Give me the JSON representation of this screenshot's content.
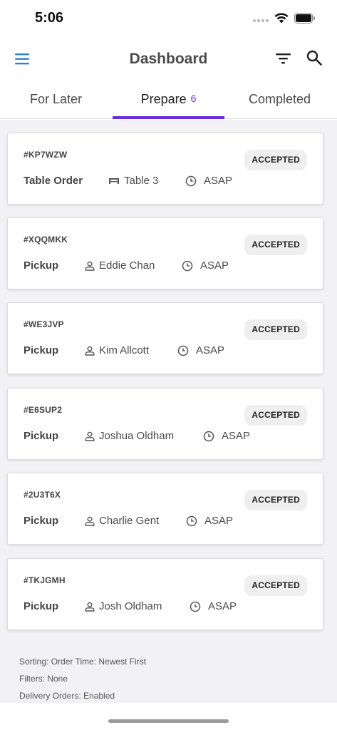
{
  "status_bar": {
    "time": "5:06"
  },
  "header": {
    "title": "Dashboard",
    "menu_icon": "hamburger-menu-icon",
    "filter_icon": "filter-icon",
    "search_icon": "search-icon",
    "accent_color": "#2f7fd6"
  },
  "tabs": [
    {
      "label": "For Later",
      "badge": ""
    },
    {
      "label": "Prepare",
      "badge": "6"
    },
    {
      "label": "Completed",
      "badge": ""
    }
  ],
  "active_tab_color": "#6a2bd8",
  "orders": [
    {
      "id": "#KP7WZW",
      "status": "ACCEPTED",
      "type": "Table Order",
      "customer_icon": "table-icon",
      "customer": "Table 3",
      "time": "ASAP"
    },
    {
      "id": "#XQQMKK",
      "status": "ACCEPTED",
      "type": "Pickup",
      "customer_icon": "person-icon",
      "customer": "Eddie Chan",
      "time": "ASAP"
    },
    {
      "id": "#WE3JVP",
      "status": "ACCEPTED",
      "type": "Pickup",
      "customer_icon": "person-icon",
      "customer": "Kim Allcott",
      "time": "ASAP"
    },
    {
      "id": "#E6SUP2",
      "status": "ACCEPTED",
      "type": "Pickup",
      "customer_icon": "person-icon",
      "customer": "Joshua Oldham",
      "time": "ASAP"
    },
    {
      "id": "#2U3T6X",
      "status": "ACCEPTED",
      "type": "Pickup",
      "customer_icon": "person-icon",
      "customer": "Charlie Gent",
      "time": "ASAP"
    },
    {
      "id": "#TKJGMH",
      "status": "ACCEPTED",
      "type": "Pickup",
      "customer_icon": "person-icon",
      "customer": "Josh Oldham",
      "time": "ASAP"
    }
  ],
  "footer": {
    "sorting": "Sorting: Order Time: Newest First",
    "filters": "Filters: None",
    "delivery": "Delivery Orders: Enabled"
  }
}
